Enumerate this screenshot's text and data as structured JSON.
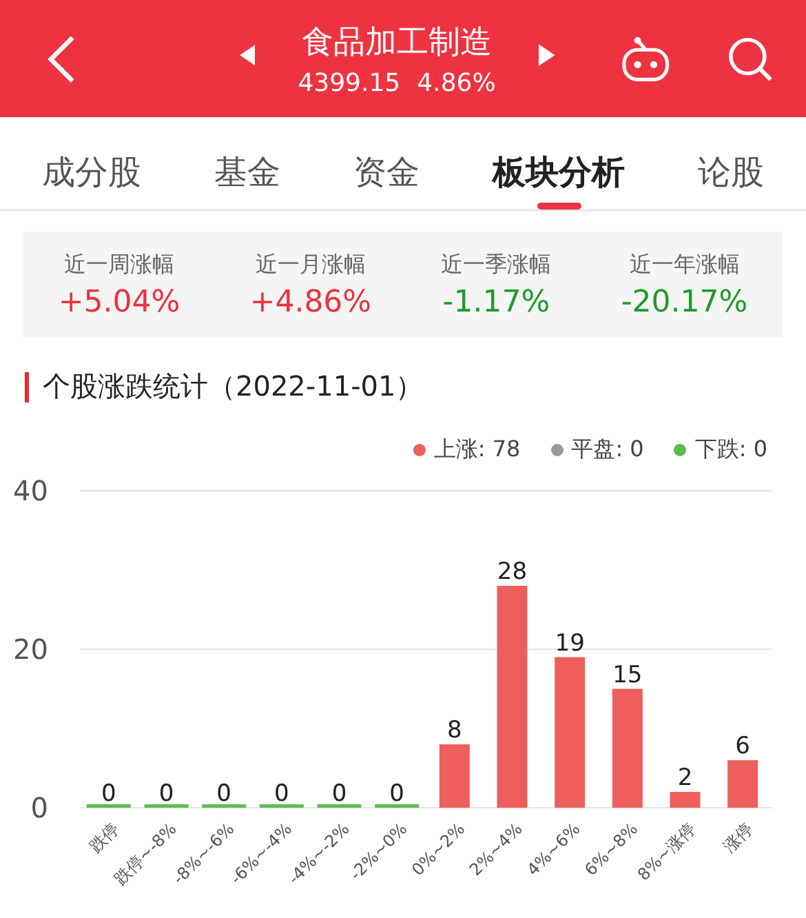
{
  "header": {
    "title": "食品加工制造",
    "price": "4399.15",
    "change": "4.86%"
  },
  "tabs": [
    {
      "label": "成分股",
      "selected": false
    },
    {
      "label": "基金",
      "selected": false
    },
    {
      "label": "资金",
      "selected": false
    },
    {
      "label": "板块分析",
      "selected": true
    },
    {
      "label": "论股",
      "selected": false
    }
  ],
  "stats": [
    {
      "label": "近一周涨幅",
      "value": "+5.04%",
      "color": "#e8333c"
    },
    {
      "label": "近一月涨幅",
      "value": "+4.86%",
      "color": "#e8333c"
    },
    {
      "label": "近一季涨幅",
      "value": "-1.17%",
      "color": "#1d9a2c"
    },
    {
      "label": "近一年涨幅",
      "value": "-20.17%",
      "color": "#1d9a2c"
    }
  ],
  "section_title": "个股涨跌统计（2022-11-01）",
  "legend": [
    {
      "label": "上涨: 78",
      "color": "#ee5f5b"
    },
    {
      "label": "平盘: 0",
      "color": "#999999"
    },
    {
      "label": "下跌: 0",
      "color": "#5cbd4f"
    }
  ],
  "chart_data": {
    "type": "bar",
    "categories": [
      "跌停",
      "跌停~-8%",
      "-8%~-6%",
      "-6%~-4%",
      "-4%~-2%",
      "-2%~0%",
      "0%~2%",
      "2%~4%",
      "4%~6%",
      "6%~8%",
      "8%~涨停",
      "涨停"
    ],
    "series": [
      {
        "color": "#5cbd4f",
        "values": [
          0,
          0,
          0,
          0,
          0,
          0,
          null,
          null,
          null,
          null,
          null,
          null
        ]
      },
      {
        "color": "#ee5f5b",
        "values": [
          null,
          null,
          null,
          null,
          null,
          null,
          8,
          28,
          19,
          15,
          2,
          6
        ]
      }
    ],
    "ylim": [
      0,
      40
    ],
    "yticks": [
      0,
      20,
      40
    ],
    "data_labels": true
  }
}
